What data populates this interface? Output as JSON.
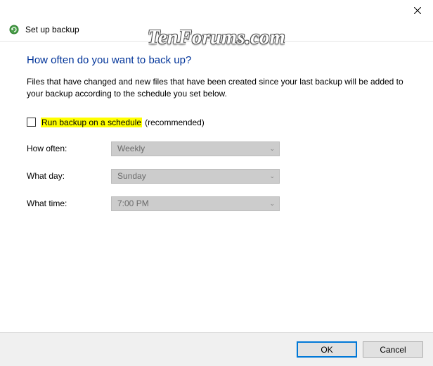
{
  "titlebar": {
    "close_tooltip": "Close"
  },
  "header": {
    "title": "Set up backup"
  },
  "main": {
    "heading": "How often do you want to back up?",
    "description": "Files that have changed and new files that have been created since your last backup will be added to your backup according to the schedule you set below.",
    "checkbox": {
      "highlighted": "Run backup on a schedule",
      "suffix": "(recommended)",
      "checked": false
    },
    "fields": {
      "how_often": {
        "label": "How often:",
        "value": "Weekly"
      },
      "what_day": {
        "label": "What day:",
        "value": "Sunday"
      },
      "what_time": {
        "label": "What time:",
        "value": "7:00 PM"
      }
    }
  },
  "footer": {
    "ok_label": "OK",
    "cancel_label": "Cancel"
  },
  "watermark": {
    "text": "TenForums.com"
  }
}
